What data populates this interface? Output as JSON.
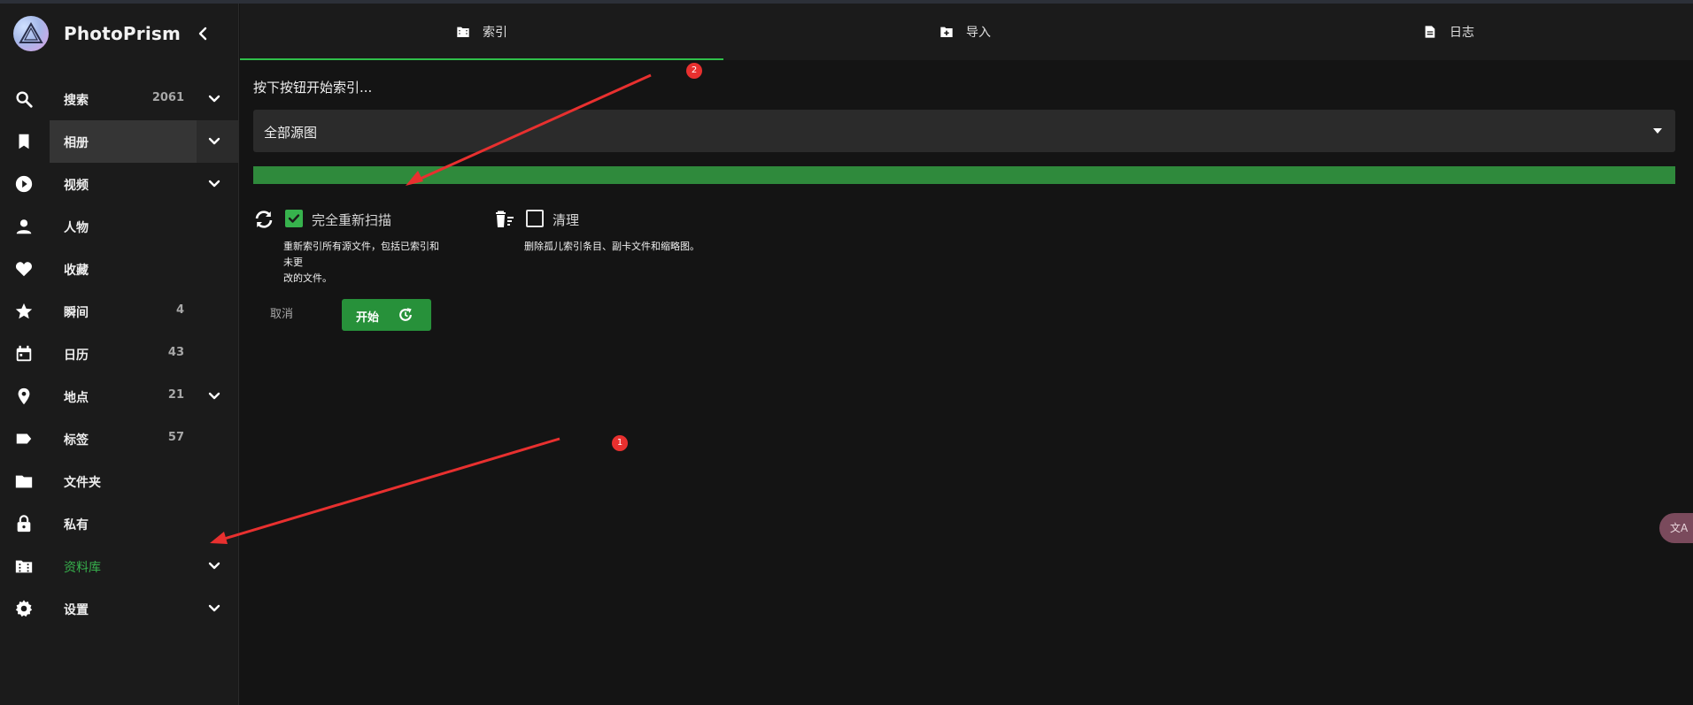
{
  "app": {
    "name": "PhotoPrism"
  },
  "sidebar": {
    "items": [
      {
        "label": "搜索",
        "count": "2061",
        "icon": "search-icon",
        "chevron": true
      },
      {
        "label": "相册",
        "count": "",
        "icon": "bookmark-icon",
        "chevron": true,
        "active": true
      },
      {
        "label": "视频",
        "count": "",
        "icon": "play-circle-icon",
        "chevron": true
      },
      {
        "label": "人物",
        "count": "",
        "icon": "person-icon",
        "chevron": false
      },
      {
        "label": "收藏",
        "count": "",
        "icon": "heart-icon",
        "chevron": false
      },
      {
        "label": "瞬间",
        "count": "4",
        "icon": "star-icon",
        "chevron": false
      },
      {
        "label": "日历",
        "count": "43",
        "icon": "calendar-icon",
        "chevron": false
      },
      {
        "label": "地点",
        "count": "21",
        "icon": "map-pin-icon",
        "chevron": true
      },
      {
        "label": "标签",
        "count": "57",
        "icon": "label-icon",
        "chevron": false
      },
      {
        "label": "文件夹",
        "count": "",
        "icon": "folder-icon",
        "chevron": false
      },
      {
        "label": "私有",
        "count": "",
        "icon": "lock-icon",
        "chevron": false
      },
      {
        "label": "资料库",
        "count": "",
        "icon": "library-icon",
        "chevron": true,
        "highlight": true
      },
      {
        "label": "设置",
        "count": "",
        "icon": "gear-icon",
        "chevron": true
      }
    ]
  },
  "tabs": [
    {
      "label": "索引",
      "icon": "folder-film-icon"
    },
    {
      "label": "导入",
      "icon": "folder-plus-icon"
    },
    {
      "label": "日志",
      "icon": "document-icon"
    }
  ],
  "index": {
    "prompt": "按下按钮开始索引...",
    "source_value": "全部源图",
    "progress": 1.0,
    "rescan_label": "完全重新扫描",
    "rescan_checked": true,
    "rescan_hint_line1": "重新索引所有源文件，包括已索引和未更",
    "rescan_hint_line2": "改的文件。",
    "cleanup_label": "清理",
    "cleanup_checked": false,
    "cleanup_hint": "删除孤儿索引条目、副卡文件和缩略图。",
    "cancel_label": "取消",
    "start_label": "开始"
  },
  "annotations": {
    "badge1": "1",
    "badge2": "2"
  },
  "translate": {
    "label": "文A"
  },
  "colors": {
    "accent": "#37b24d",
    "progress_bg": "#244b2a",
    "annotation": "#e8302f"
  }
}
